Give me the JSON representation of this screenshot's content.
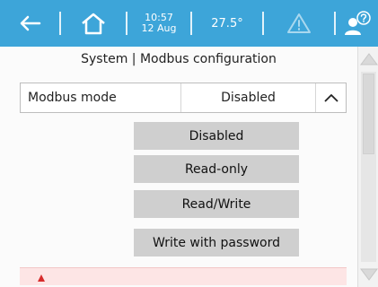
{
  "header": {
    "time": "10:57",
    "date": "12 Aug",
    "temperature": "27.5°",
    "icons": {
      "back": "back-arrow-icon",
      "home": "home-icon",
      "warning": "warning-icon",
      "user_help": "user-help-icon"
    },
    "bar_color": "#3da5d9"
  },
  "page": {
    "title": "System | Modbus configuration"
  },
  "modbus_mode": {
    "label": "Modbus mode",
    "value": "Disabled",
    "toggle_icon": "chevron-up-icon"
  },
  "options": [
    "Disabled",
    "Read-only",
    "Read/Write",
    "Write with password"
  ],
  "alert": {
    "marker_color": "#d62b2b",
    "background": "#fde5e5"
  },
  "scrollbar": {
    "up_icon": "scroll-up-icon",
    "down_icon": "scroll-down-icon"
  }
}
